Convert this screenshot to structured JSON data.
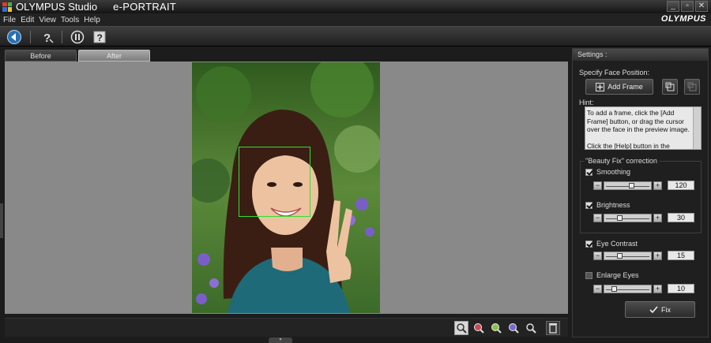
{
  "window": {
    "app_title": "OLYMPUS Studio",
    "module_title": "e-PORTRAIT",
    "brand": "OLYMPUS",
    "controls": [
      "_",
      "▫",
      "✕"
    ]
  },
  "menu": [
    "File",
    "Edit",
    "View",
    "Tools",
    "Help"
  ],
  "toolbar": {
    "icons": [
      "back-icon",
      "help-question-icon",
      "info-icon",
      "help-icon"
    ]
  },
  "view_tabs": [
    {
      "label": "Before",
      "selected": false
    },
    {
      "label": "After",
      "selected": true
    }
  ],
  "settings": {
    "header": "Settings :",
    "face_position_label": "Specify Face Position:",
    "add_frame_label": "Add Frame",
    "hint_label": "Hint:",
    "hint_text": "To add a frame, click the [Add Frame] button, or drag the cursor over the face in the preview image.\n\nClick the [Help] button in the Toolbar",
    "beauty_fix_label": "\"Beauty Fix\" correction",
    "controls": [
      {
        "label": "Smoothing",
        "checked": true,
        "value": "120",
        "level": 0.6
      },
      {
        "label": "Brightness",
        "checked": true,
        "value": "30",
        "level": 0.3
      },
      {
        "label": "Eye Contrast",
        "checked": true,
        "value": "15",
        "level": 0.3
      },
      {
        "label": "Enlarge Eyes",
        "checked": false,
        "value": "10",
        "level": 0.15
      }
    ],
    "fix_label": "Fix",
    "minus": "−",
    "plus": "+"
  },
  "bottom_tools": [
    "zoom-fit-icon",
    "zoom-in-icon",
    "zoom-actual-icon",
    "zoom-out-icon",
    "zoom-icon",
    "trash-icon"
  ]
}
